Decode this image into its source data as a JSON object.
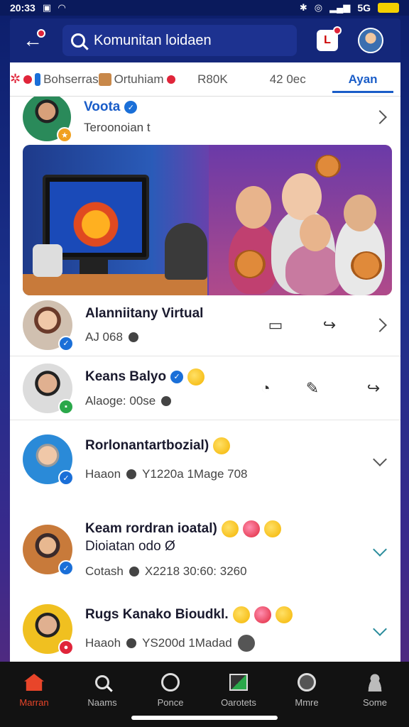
{
  "status_bar": {
    "time": "20:33",
    "network": "5G"
  },
  "header": {
    "search_text": "Komunitan loidaen",
    "notif_label": "L"
  },
  "tabs": [
    {
      "label": "Bohserras"
    },
    {
      "label": "Ortuhiam"
    },
    {
      "label": "R80K"
    },
    {
      "label": "42 0ec"
    },
    {
      "label": "Ayan"
    }
  ],
  "feed": {
    "top_row": {
      "name": "Voota",
      "meta": "Teroonoian t"
    },
    "items": [
      {
        "name": "Alanniitany Virtual",
        "meta": "AJ 068"
      },
      {
        "name": "Keans Balyo",
        "meta": "Alaoge: 00se"
      },
      {
        "name": "Rorlonantartbozial)",
        "meta_a": "Haaon",
        "meta_b": "Y1220a 1Mage 708"
      },
      {
        "name": "Keam rordran ioatal)",
        "name2": "Dioiatan odo Ø",
        "meta_a": "Cotash",
        "meta_b": "X2218 30:60: 3260"
      },
      {
        "name": "Rugs Kanako Bioudkl.",
        "meta_a": "Haaoh",
        "meta_b": "YS200d 1Madad"
      }
    ]
  },
  "bottom_nav": [
    {
      "label": "Marran",
      "icon": "home-icon"
    },
    {
      "label": "Naams",
      "icon": "search-icon"
    },
    {
      "label": "Ponce",
      "icon": "clock-icon"
    },
    {
      "label": "Oarotets",
      "icon": "image-icon"
    },
    {
      "label": "Mmre",
      "icon": "face-icon"
    },
    {
      "label": "Some",
      "icon": "profile-icon"
    }
  ],
  "colors": {
    "accent": "#1a5dc8",
    "nav_active": "#e8452a",
    "header_bg": "#14277a",
    "badge_red": "#e0253a"
  }
}
